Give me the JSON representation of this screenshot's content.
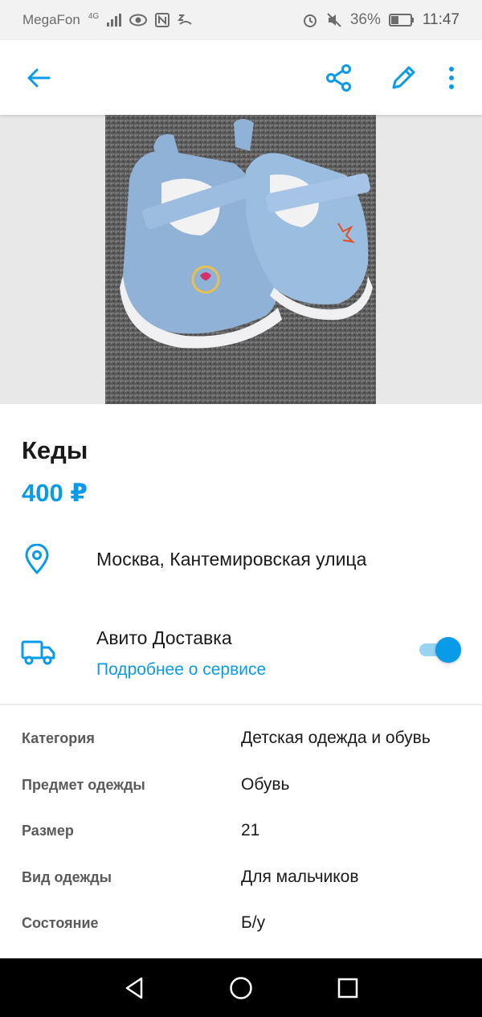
{
  "status_bar": {
    "carrier": "MegaFon",
    "network": "4G",
    "battery": "36%",
    "time": "11:47"
  },
  "app_bar": {
    "icons": [
      "back-arrow-icon",
      "share-icon",
      "edit-icon",
      "more-vert-icon"
    ]
  },
  "listing": {
    "title": "Кеды",
    "price": "400 ₽",
    "location": "Москва, Кантемировская улица",
    "delivery": {
      "title": "Авито Доставка",
      "link": "Подробнее о сервисе",
      "enabled": true
    }
  },
  "params": [
    {
      "label": "Категория",
      "value": "Детская одежда и обувь"
    },
    {
      "label": "Предмет одежды",
      "value": "Обувь"
    },
    {
      "label": "Размер",
      "value": "21"
    },
    {
      "label": "Вид одежды",
      "value": "Для мальчиков"
    },
    {
      "label": "Состояние",
      "value": "Б/у"
    }
  ],
  "colors": {
    "accent": "#0a9be8",
    "background": "#ffffff",
    "nav_bar": "#000000"
  }
}
